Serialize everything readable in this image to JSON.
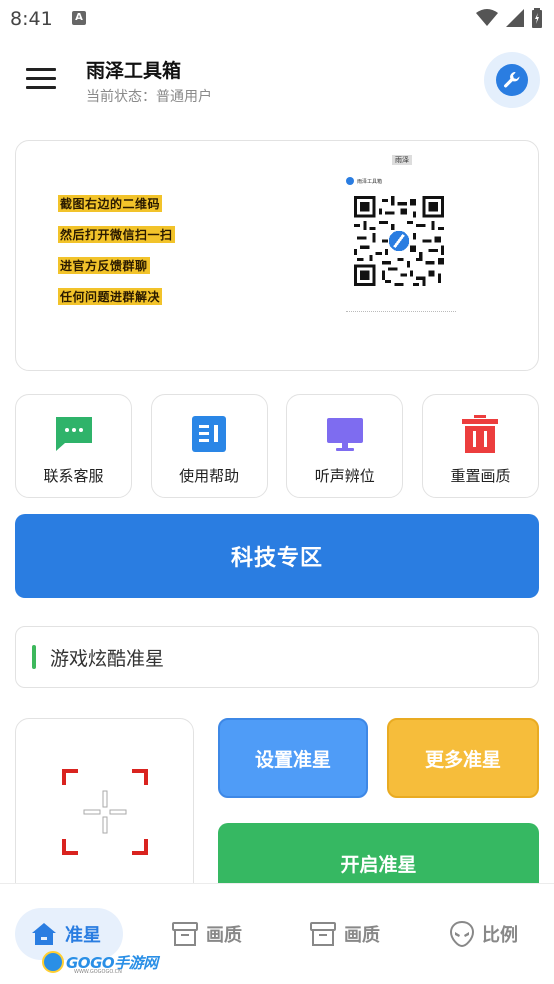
{
  "status_bar": {
    "time": "8:41",
    "notification_glyph": "A"
  },
  "header": {
    "title": "雨泽工具箱",
    "subtitle": "当前状态：普通用户",
    "tool_icon": "wrench-icon"
  },
  "banner": {
    "lines": [
      "截图右边的二维码",
      "然后打开微信扫一扫",
      "进官方反馈群聊",
      "任何问题进群解决"
    ],
    "qr_top_label": "雨泽",
    "qr_brand": "雨泽工具箱"
  },
  "quick_actions": [
    {
      "label": "联系客服",
      "icon": "chat-icon",
      "color": "#2fb36a"
    },
    {
      "label": "使用帮助",
      "icon": "document-icon",
      "color": "#2a86e6"
    },
    {
      "label": "听声辨位",
      "icon": "monitor-icon",
      "color": "#7e6cf0"
    },
    {
      "label": "重置画质",
      "icon": "trash-icon",
      "color": "#ec3d3d"
    }
  ],
  "tech_zone": {
    "label": "科技专区"
  },
  "section": {
    "title": "游戏炫酷准星"
  },
  "crosshair": {
    "icon": "crosshair-icon",
    "color": "#d9231f"
  },
  "buttons": {
    "set": "设置准星",
    "more": "更多准星",
    "start": "开启准星"
  },
  "bottom_nav": [
    {
      "label": "准星",
      "icon": "home-icon",
      "active": true
    },
    {
      "label": "画质",
      "icon": "archive-icon",
      "active": false
    },
    {
      "label": "画质",
      "icon": "archive-icon",
      "active": false
    },
    {
      "label": "比例",
      "icon": "alien-icon",
      "active": false
    }
  ],
  "watermark": {
    "text": "GOGO手游网",
    "url": "WWW.GOGOGO.CN"
  },
  "colors": {
    "primary": "#2a7de1",
    "green": "#36b862",
    "yellow": "#f6bd3b",
    "blue_light": "#4f9cf7"
  }
}
